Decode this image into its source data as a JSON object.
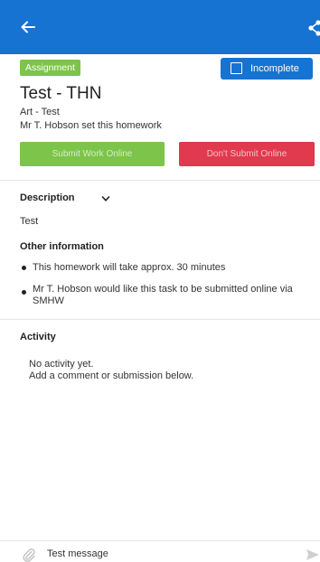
{
  "header": {
    "back_icon": "arrow-left-icon",
    "share_icon": "share-icon",
    "bar_color": "#1673d1"
  },
  "homework": {
    "badge": "Assignment",
    "status_label": "Incomplete",
    "title": "Test - THN",
    "subject": "Art - Test",
    "set_by": "Mr T. Hobson set this homework",
    "green_button_label": "Submit Work Online",
    "red_button_label": "Don't Submit Online"
  },
  "description": {
    "heading": "Description",
    "text": "Test"
  },
  "other_information": {
    "heading": "Other information",
    "items": [
      "This homework will take approx. 30 minutes",
      "Mr T. Hobson would like this task to be submitted online via SMHW"
    ]
  },
  "activity": {
    "heading": "Activity",
    "empty_line1": "No activity yet.",
    "empty_line2": "Add a comment or submission below."
  },
  "composer": {
    "value": "Test message",
    "attach_icon": "paperclip-icon",
    "send_icon": "send-icon"
  },
  "colors": {
    "primary": "#1673d1",
    "success": "#7cc44a",
    "danger": "#e1394d"
  }
}
